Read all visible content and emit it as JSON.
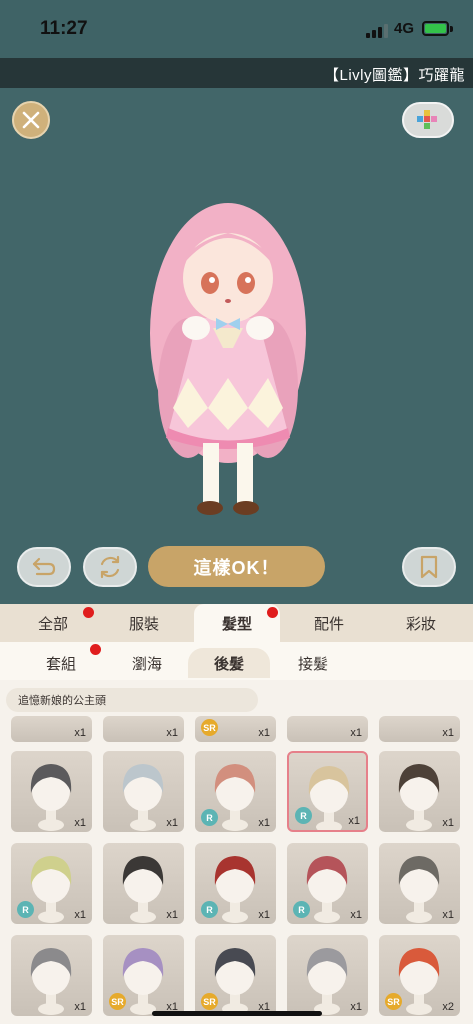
{
  "status": {
    "time": "11:27",
    "network": "4G"
  },
  "header": {
    "title": "【Livly圖鑑】巧躍龍"
  },
  "stage": {
    "ok_label": "這樣OK！"
  },
  "categories": [
    {
      "label": "全部",
      "notify": true
    },
    {
      "label": "服裝",
      "notify": false
    },
    {
      "label": "髮型",
      "notify": true,
      "active": true
    },
    {
      "label": "配件",
      "notify": false
    },
    {
      "label": "彩妝",
      "notify": false
    }
  ],
  "subtabs": [
    {
      "label": "套組",
      "notify": true
    },
    {
      "label": "瀏海",
      "notify": false
    },
    {
      "label": "後髮",
      "notify": false,
      "active": true
    },
    {
      "label": "接髮",
      "notify": false
    }
  ],
  "items": {
    "set_name": "追憶新娘的公主頭",
    "top_row": [
      {
        "count": "x1",
        "rarity": ""
      },
      {
        "count": "x1",
        "rarity": ""
      },
      {
        "count": "x1",
        "rarity": "SR"
      },
      {
        "count": "x1",
        "rarity": ""
      },
      {
        "count": "x1",
        "rarity": ""
      }
    ],
    "rows": [
      [
        {
          "count": "x1",
          "rarity": "",
          "hair": "#5b5a5c"
        },
        {
          "count": "x1",
          "rarity": "",
          "hair": "#bcc6cc"
        },
        {
          "count": "x1",
          "rarity": "R",
          "hair": "#d28f7e"
        },
        {
          "count": "x1",
          "rarity": "R",
          "hair": "#d8c49d",
          "selected": true
        },
        {
          "count": "x1",
          "rarity": "",
          "hair": "#4d4138"
        }
      ],
      [
        {
          "count": "x1",
          "rarity": "R",
          "hair": "#cfd08d"
        },
        {
          "count": "x1",
          "rarity": "",
          "hair": "#3b3836"
        },
        {
          "count": "x1",
          "rarity": "R",
          "hair": "#a8342f"
        },
        {
          "count": "x1",
          "rarity": "R",
          "hair": "#b5545a"
        },
        {
          "count": "x1",
          "rarity": "",
          "hair": "#6d6a64"
        }
      ],
      [
        {
          "count": "x1",
          "rarity": "",
          "hair": "#8b8a8c"
        },
        {
          "count": "x1",
          "rarity": "SR",
          "hair": "#a690c2"
        },
        {
          "count": "x1",
          "rarity": "SR",
          "hair": "#484a52"
        },
        {
          "count": "x1",
          "rarity": "",
          "hair": "#9b9a9e"
        },
        {
          "count": "x2",
          "rarity": "SR",
          "hair": "#d95a3b"
        }
      ]
    ]
  },
  "colors": {
    "accent": "#c8a468",
    "stage_bg": "#426669",
    "notify": "#e01d1d"
  }
}
